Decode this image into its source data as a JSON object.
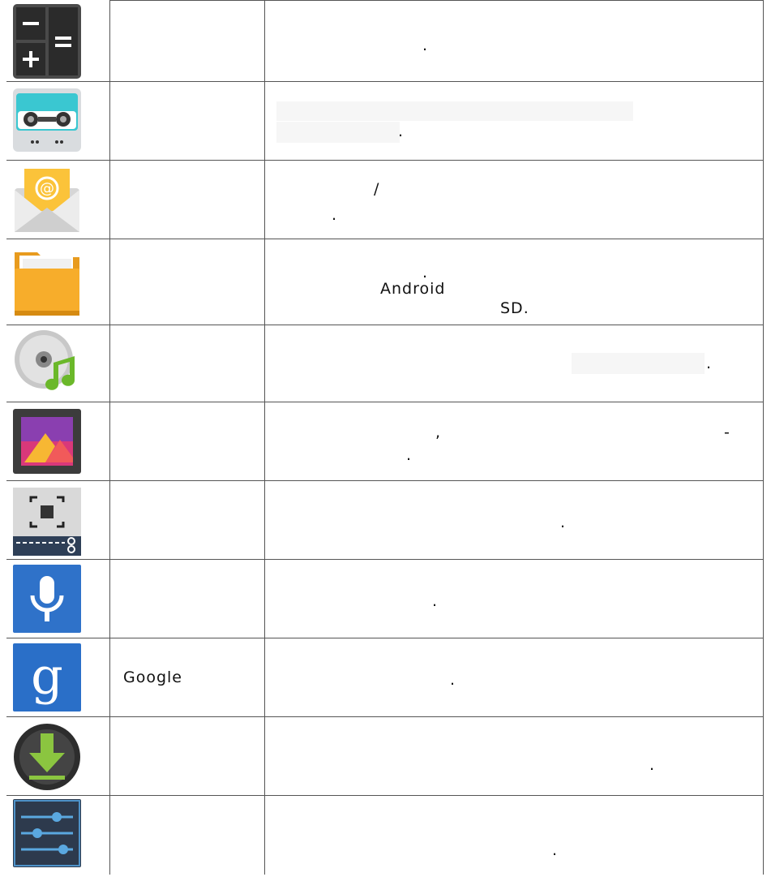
{
  "rows": [
    {
      "icon": "calculator-icon",
      "name": "",
      "desc": [
        "."
      ]
    },
    {
      "icon": "sound-recorder-icon",
      "name": "",
      "desc": [
        "."
      ]
    },
    {
      "icon": "email-icon",
      "name": "",
      "desc": [
        "/",
        "."
      ]
    },
    {
      "icon": "file-manager-icon",
      "name": "",
      "desc": [
        ".",
        "Android",
        "SD."
      ]
    },
    {
      "icon": "music-icon",
      "name": "",
      "desc": [
        "."
      ]
    },
    {
      "icon": "gallery-icon",
      "name": "",
      "desc": [
        ",",
        "-",
        "."
      ]
    },
    {
      "icon": "screenshot-icon",
      "name": "",
      "desc": [
        "."
      ]
    },
    {
      "icon": "voice-search-icon",
      "name": "",
      "desc": [
        "."
      ]
    },
    {
      "icon": "google-search-icon",
      "name": "Google",
      "desc": [
        "."
      ]
    },
    {
      "icon": "downloads-icon",
      "name": "",
      "desc": [
        "."
      ]
    },
    {
      "icon": "settings-icon",
      "name": "",
      "desc": [
        "."
      ]
    }
  ]
}
